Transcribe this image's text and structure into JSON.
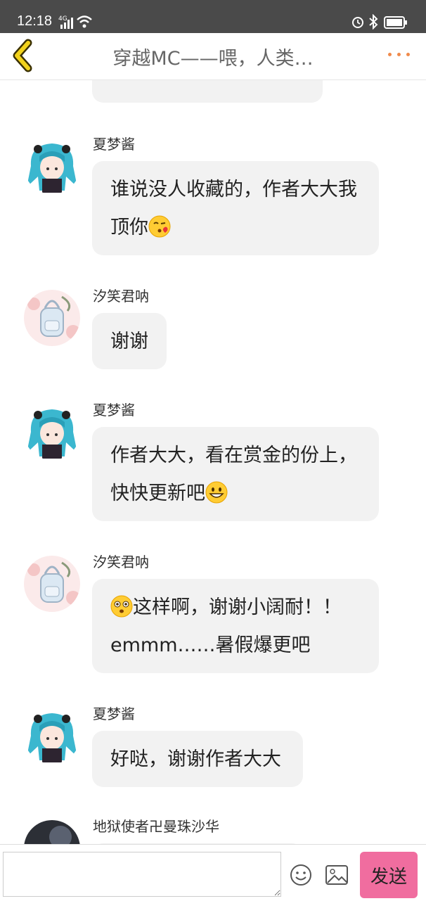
{
  "status_bar": {
    "time": "12:18",
    "network": "4G"
  },
  "header": {
    "title": "穿越MC——喂，人类…"
  },
  "messages": [
    {
      "sender": "夏梦酱",
      "text": "谁说没人收藏的，作者大大我顶你",
      "emoji_after": "kissing-heart-emoji"
    },
    {
      "sender": "汐笑君呐",
      "text": "谢谢"
    },
    {
      "sender": "夏梦酱",
      "text": "作者大大，看在赏金的份上，快快更新吧",
      "emoji_after": "grinning-emoji"
    },
    {
      "sender": "汐笑君呐",
      "emoji_before": "flushed-emoji",
      "text": "这样啊，谢谢小阔耐！！emmm……暑假爆更吧"
    },
    {
      "sender": "夏梦酱",
      "text": "好哒，谢谢作者大大"
    },
    {
      "sender": "地狱使者卍曼珠沙华"
    }
  ],
  "input_bar": {
    "placeholder": "",
    "send_label": "发送"
  },
  "icons": [
    "back-chevron-icon",
    "more-dots-icon",
    "emoji-icon",
    "image-icon",
    "alarm-icon",
    "bluetooth-icon",
    "battery-icon",
    "wifi-icon",
    "signal-icon"
  ],
  "colors": {
    "send_button": "#f06d9f",
    "accent_dots": "#f08a4b",
    "back_arrow": "#f2d21b",
    "bubble": "#f2f2f2"
  }
}
